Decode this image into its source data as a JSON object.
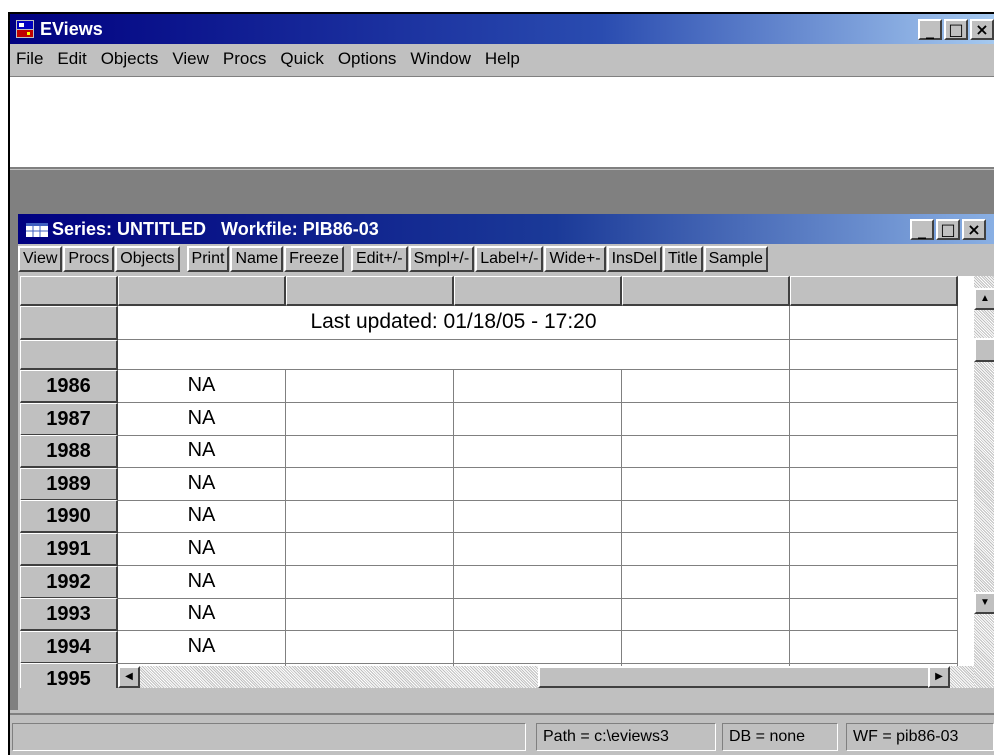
{
  "app": {
    "title": "EViews"
  },
  "menubar": {
    "items": [
      {
        "label": "File"
      },
      {
        "label": "Edit"
      },
      {
        "label": "Objects"
      },
      {
        "label": "View"
      },
      {
        "label": "Procs"
      },
      {
        "label": "Quick"
      },
      {
        "label": "Options"
      },
      {
        "label": "Window"
      },
      {
        "label": "Help"
      }
    ]
  },
  "window_buttons": {
    "minimize": "_",
    "maximize": "□",
    "close": "×"
  },
  "series_window": {
    "title": "Series: UNTITLED   Workfile: PIB86-03",
    "toolbar": [
      "View",
      "Procs",
      "Objects",
      "Print",
      "Name",
      "Freeze",
      "Edit+/-",
      "Smpl+/-",
      "Label+/-",
      "Wide+-",
      "InsDel",
      "Title",
      "Sample"
    ],
    "last_updated": "Last updated: 01/18/05 - 17:20",
    "rows": [
      {
        "year": "1986",
        "value": "NA"
      },
      {
        "year": "1987",
        "value": "NA"
      },
      {
        "year": "1988",
        "value": "NA"
      },
      {
        "year": "1989",
        "value": "NA"
      },
      {
        "year": "1990",
        "value": "NA"
      },
      {
        "year": "1991",
        "value": "NA"
      },
      {
        "year": "1992",
        "value": "NA"
      },
      {
        "year": "1993",
        "value": "NA"
      },
      {
        "year": "1994",
        "value": "NA"
      },
      {
        "year": "1995",
        "value": ""
      }
    ]
  },
  "statusbar": {
    "path": "Path = c:\\eviews3",
    "db": "DB = none",
    "wf": "WF = pib86-03"
  },
  "colors": {
    "titlebar": "#000080",
    "face": "#c0c0c0",
    "workspace": "#808080"
  }
}
